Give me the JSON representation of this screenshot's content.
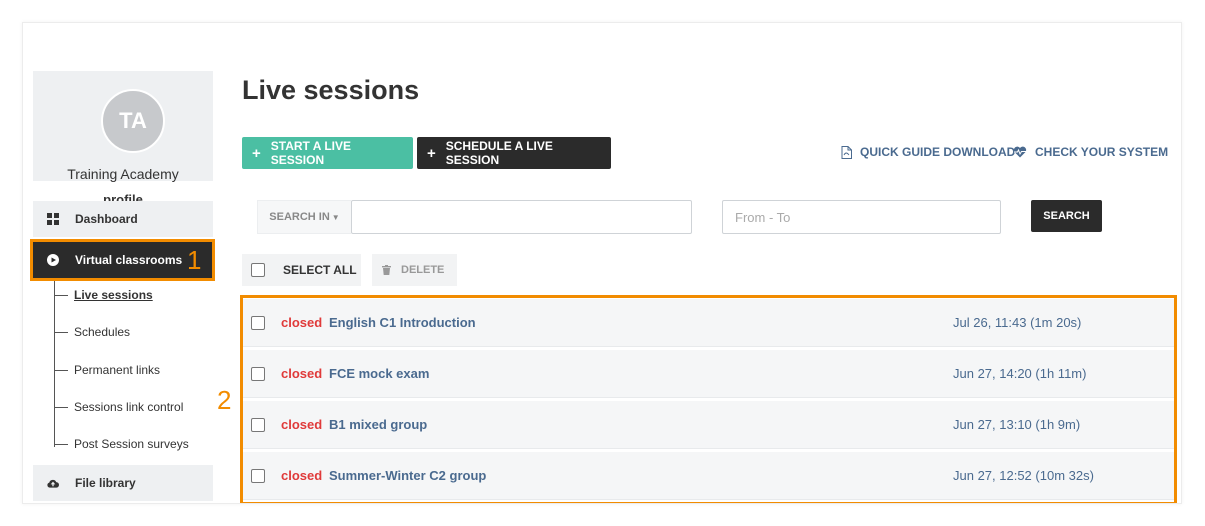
{
  "sidebar": {
    "avatar_initials": "TA",
    "profile_name": "Training Academy",
    "profile_link": "profile",
    "nav": {
      "dashboard": "Dashboard",
      "virtual_classrooms": "Virtual classrooms",
      "file_library": "File library"
    },
    "sub_items": [
      "Live sessions",
      "Schedules",
      "Permanent links",
      "Sessions link control",
      "Post Session surveys"
    ]
  },
  "annotations": {
    "marker1": "1",
    "marker2": "2",
    "accent_color": "#f28c00"
  },
  "main": {
    "title": "Live sessions",
    "start_button": "START A LIVE SESSION",
    "schedule_button": "SCHEDULE A LIVE SESSION",
    "quick_guide": "QUICK GUIDE DOWNLOAD",
    "check_system": "CHECK YOUR SYSTEM",
    "search_in": "SEARCH IN",
    "search_value": "",
    "date_placeholder": "From - To",
    "search_button": "SEARCH",
    "select_all": "SELECT ALL",
    "delete": "DELETE",
    "sessions": [
      {
        "status": "closed",
        "name": "English C1 Introduction",
        "date": "Jul 26, 11:43 (1m 20s)"
      },
      {
        "status": "closed",
        "name": "FCE mock exam",
        "date": "Jun 27, 14:20 (1h 11m)"
      },
      {
        "status": "closed",
        "name": "B1 mixed group",
        "date": "Jun 27, 13:10 (1h 9m)"
      },
      {
        "status": "closed",
        "name": "Summer-Winter C2 group",
        "date": "Jun 27, 12:52 (10m 32s)"
      }
    ]
  },
  "colors": {
    "start_button": "#4bbfa3",
    "dark": "#2b2b2b",
    "status_closed": "#e03a3a",
    "link": "#4a6a8f"
  }
}
